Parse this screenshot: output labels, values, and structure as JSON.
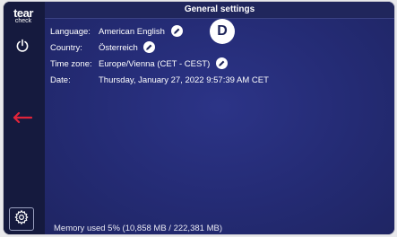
{
  "logo": {
    "main": "tear",
    "sub": "check"
  },
  "sidebar": {
    "power_icon": "power-icon",
    "back_icon": "arrow-left-icon",
    "settings_icon": "gear-icon",
    "back_color": "#e0243a"
  },
  "header": {
    "title": "General settings"
  },
  "settings": {
    "language": {
      "label": "Language:",
      "value": "American English",
      "editable": true
    },
    "country": {
      "label": "Country:",
      "value": "Österreich",
      "editable": true
    },
    "timezone": {
      "label": "Time zone:",
      "value": "Europe/Vienna (CET - CEST)",
      "editable": true
    },
    "date": {
      "label": "Date:",
      "value": "Thursday, January 27, 2022 9:57:39 AM CET"
    }
  },
  "marker": {
    "text": "D"
  },
  "footer": {
    "memory": "Memory used 5% (10,858 MB / 222,381 MB)"
  }
}
